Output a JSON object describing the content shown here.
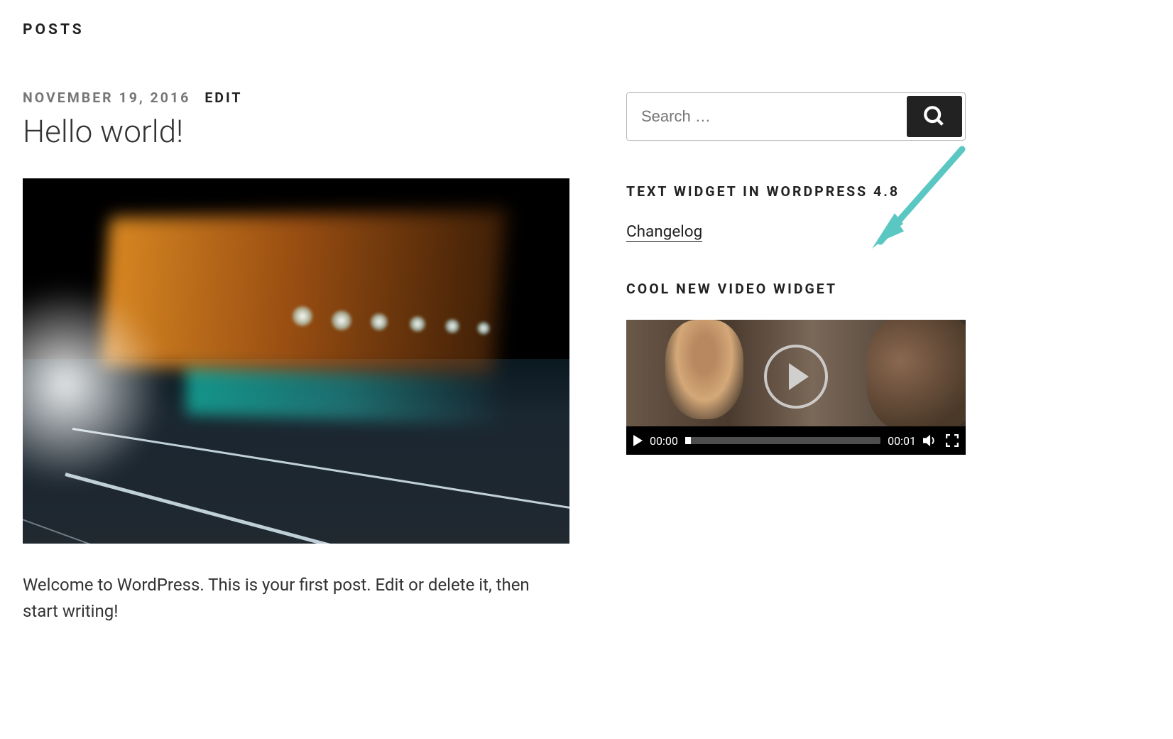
{
  "section_label": "POSTS",
  "post": {
    "date": "NOVEMBER 19, 2016",
    "edit_label": "EDIT",
    "title": "Hello world!",
    "body": "Welcome to WordPress. This is your first post. Edit or delete it, then start writing!"
  },
  "sidebar": {
    "search_placeholder": "Search …",
    "widget1": {
      "title": "TEXT WIDGET IN WORDPRESS 4.8",
      "link_text": "Changelog"
    },
    "widget2": {
      "title": "COOL NEW VIDEO WIDGET",
      "video": {
        "current_time": "00:00",
        "duration": "00:01"
      }
    }
  },
  "annotation": {
    "arrow_color": "#5bc7c2"
  }
}
